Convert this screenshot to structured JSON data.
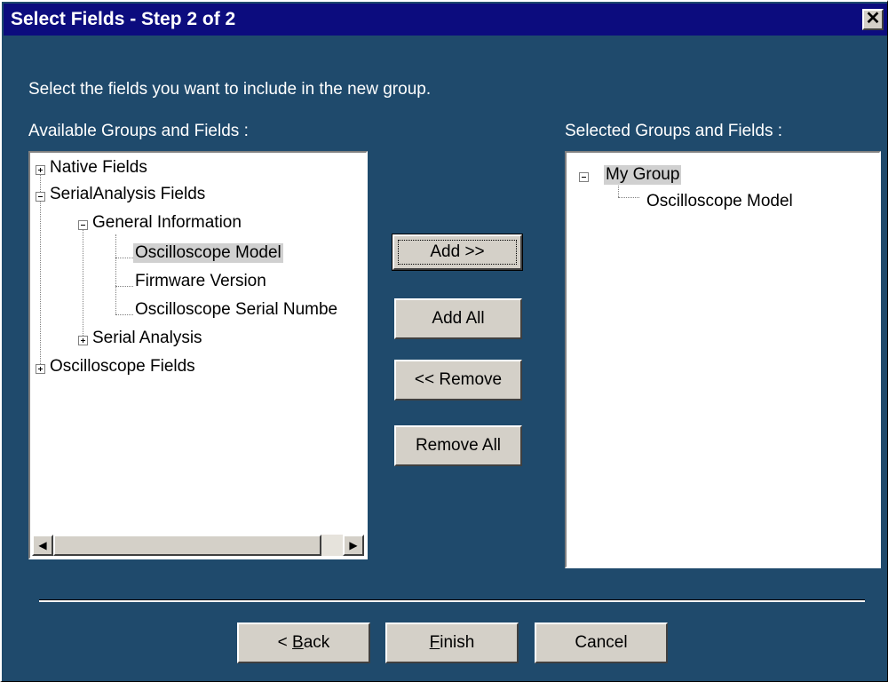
{
  "window": {
    "title": "Select Fields - Step 2 of 2",
    "close_glyph": "✕"
  },
  "instruction": "Select the fields you want to include in the new group.",
  "available": {
    "label": "Available Groups and Fields :",
    "nodes": [
      {
        "label": "Native Fields",
        "expander": "+"
      },
      {
        "label": "SerialAnalysis Fields",
        "expander": "-"
      },
      {
        "label": "General Information",
        "expander": "-"
      },
      {
        "label": "Oscilloscope Model",
        "selected": true
      },
      {
        "label": "Firmware Version"
      },
      {
        "label": "Oscilloscope Serial Numbe"
      },
      {
        "label": "Serial Analysis",
        "expander": "+"
      },
      {
        "label": "Oscilloscope Fields",
        "expander": "+"
      }
    ],
    "scroll_left_glyph": "◀",
    "scroll_right_glyph": "▶"
  },
  "selected": {
    "label": "Selected Groups and Fields :",
    "nodes": [
      {
        "label": "My Group",
        "expander": "-",
        "selected": true
      },
      {
        "label": "Oscilloscope Model"
      }
    ]
  },
  "buttons": {
    "add": "Add >>",
    "add_all": "Add All",
    "remove": "<< Remove",
    "remove_all": "Remove All"
  },
  "footer": {
    "back_prefix": "< ",
    "back_mnemonic": "B",
    "back_rest": "ack",
    "finish_mnemonic": "F",
    "finish_rest": "inish",
    "cancel": "Cancel"
  }
}
